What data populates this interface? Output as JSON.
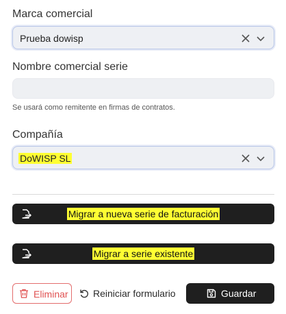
{
  "form": {
    "marca": {
      "label": "Marca comercial",
      "value": "Prueba dowisp"
    },
    "nombre": {
      "label": "Nombre comercial serie",
      "value": "",
      "help": "Se usará como remitente en firmas de contratos."
    },
    "compania": {
      "label": "Compañía",
      "value": "DoWISP SL"
    }
  },
  "actions": {
    "migrate_new": "Migrar a nueva serie de facturación",
    "migrate_existing": "Migrar a serie existente",
    "delete": "Eliminar",
    "reset": "Reiniciar formulario",
    "save": "Guardar"
  },
  "icons": {
    "clear": "x-icon",
    "dropdown": "chevron-down-icon",
    "migrate": "file-export-icon",
    "delete": "trash-icon",
    "reset": "rotate-ccw-icon",
    "save": "floppy-disk-icon"
  },
  "colors": {
    "highlight": "#ffff33",
    "dark_button": "#1f1f1f",
    "danger": "#e05252",
    "field_bg": "#eef0f4"
  }
}
